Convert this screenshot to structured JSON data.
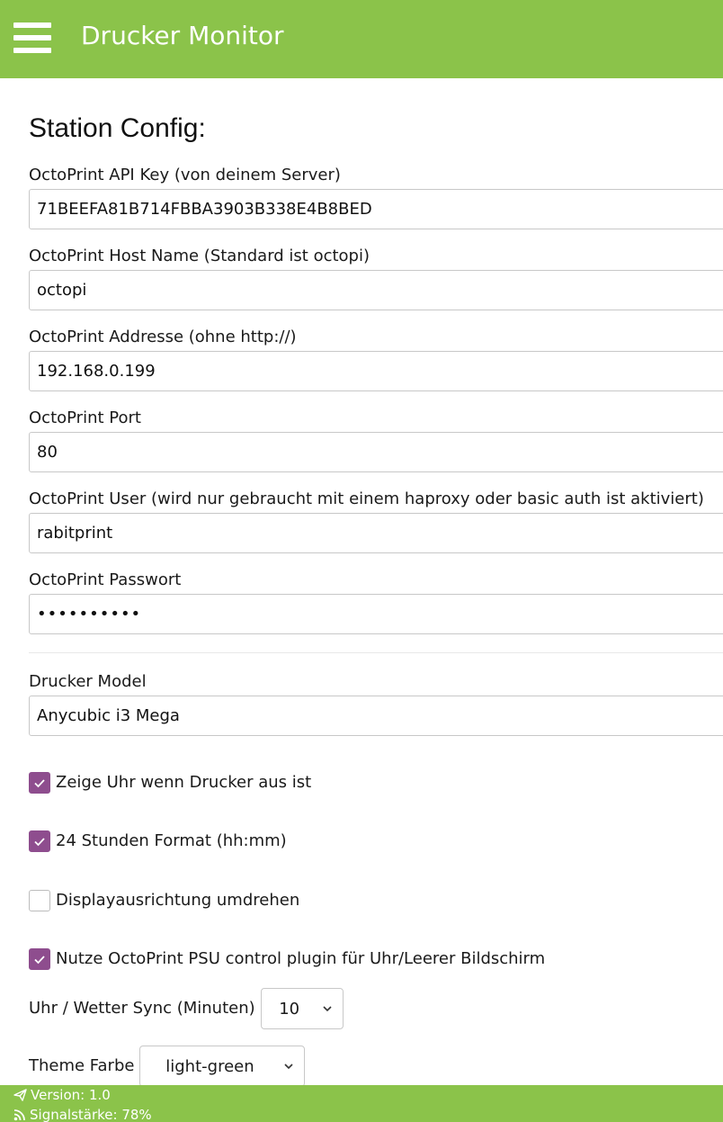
{
  "header": {
    "title": "Drucker Monitor"
  },
  "page": {
    "title": "Station Config:"
  },
  "fields": {
    "api_key": {
      "label": "OctoPrint API Key (von deinem Server)",
      "value": "71BEEFA81B714FBBA3903B338E4B8BED"
    },
    "host_name": {
      "label": "OctoPrint Host Name (Standard ist octopi)",
      "value": "octopi"
    },
    "address": {
      "label": "OctoPrint Addresse (ohne http://)",
      "value": "192.168.0.199"
    },
    "port": {
      "label": "OctoPrint Port",
      "value": "80"
    },
    "user": {
      "label": "OctoPrint User (wird nur gebraucht mit einem haproxy oder basic auth ist aktiviert)",
      "value": "rabitprint"
    },
    "password": {
      "label": "OctoPrint Passwort",
      "value": "••••••••••"
    },
    "printer_model": {
      "label": "Drucker Model",
      "value": "Anycubic i3 Mega"
    }
  },
  "checkboxes": [
    {
      "label": "Zeige Uhr wenn Drucker aus ist",
      "checked": true
    },
    {
      "label": "24 Stunden Format (hh:mm)",
      "checked": true
    },
    {
      "label": "Displayausrichtung umdrehen",
      "checked": false
    },
    {
      "label": "Nutze OctoPrint PSU control plugin für Uhr/Leerer Bildschirm",
      "checked": true
    }
  ],
  "sync": {
    "label": "Uhr / Wetter Sync (Minuten)",
    "value": "10"
  },
  "theme": {
    "label": "Theme Farbe",
    "value": "light-green"
  },
  "footer": {
    "version": "Version: 1.0",
    "signal": "Signalstärke: 78%"
  },
  "colors": {
    "header_bg": "#8bc34a",
    "checkbox_checked": "#8e4d8e"
  },
  "icons": {
    "menu": "hamburger-menu-icon",
    "version": "paper-plane-icon",
    "signal": "rss-icon",
    "select": "chevron-down-icon",
    "check": "checkmark-icon"
  }
}
